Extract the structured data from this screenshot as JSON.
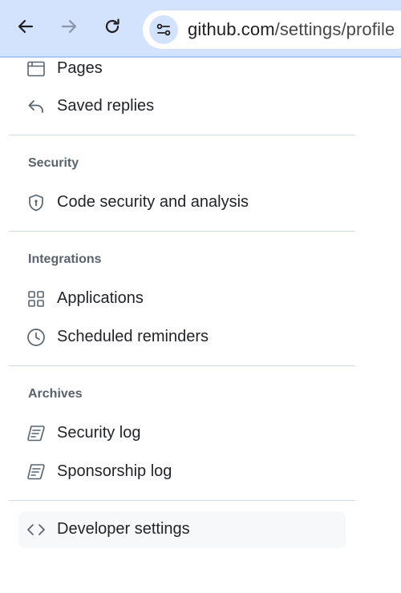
{
  "browser": {
    "url_domain": "github.com",
    "url_path": "/settings/profile"
  },
  "nav": {
    "pages": "Pages",
    "saved_replies": "Saved replies",
    "security_heading": "Security",
    "code_security": "Code security and analysis",
    "integrations_heading": "Integrations",
    "applications": "Applications",
    "scheduled_reminders": "Scheduled reminders",
    "archives_heading": "Archives",
    "security_log": "Security log",
    "sponsorship_log": "Sponsorship log",
    "developer_settings": "Developer settings"
  },
  "icons": {
    "back": "arrow-left-icon",
    "forward": "arrow-right-icon",
    "reload": "reload-icon",
    "site_info": "tune-icon",
    "pages": "browser-icon",
    "saved_replies": "reply-icon",
    "code_security": "shield-icon",
    "applications": "apps-icon",
    "scheduled_reminders": "clock-icon",
    "security_log": "log-icon",
    "sponsorship_log": "log-icon",
    "developer_settings": "code-icon"
  },
  "colors": {
    "toolbar_bg": "#d3e3fd",
    "selected_bg": "#f6f8fa",
    "heading_text": "#59636e",
    "divider": "#d1d9e0"
  }
}
